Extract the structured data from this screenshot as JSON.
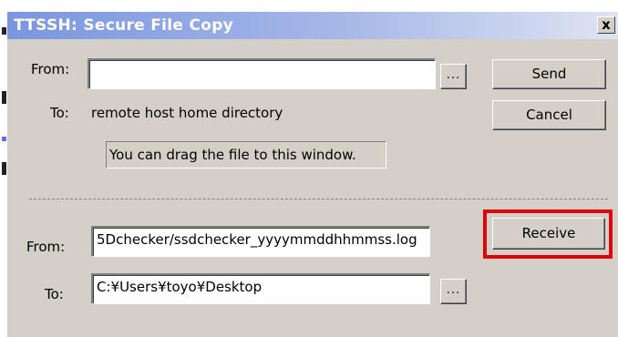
{
  "window": {
    "title": "TTSSH: Secure File Copy",
    "close_label": "x"
  },
  "send_section": {
    "from_label": "From:",
    "from_value": "",
    "browse_label": "...",
    "to_label": "To:",
    "to_value": "remote host home directory",
    "send_label": "Send",
    "cancel_label": "Cancel",
    "drop_hint": "You can drag the file to this window."
  },
  "receive_section": {
    "from_label": "From:",
    "from_value": "5Dchecker/ssdchecker_yyyymmddhhmmss.log",
    "to_label": "To:",
    "to_value": "C:¥Users¥toyo¥Desktop",
    "browse_label": "...",
    "receive_label": "Receive"
  },
  "colors": {
    "title_gradient_start": "#7a96df",
    "title_gradient_end": "#dfe4f3",
    "highlight": "#e0000a",
    "dialog_face": "#d4d0c8"
  }
}
